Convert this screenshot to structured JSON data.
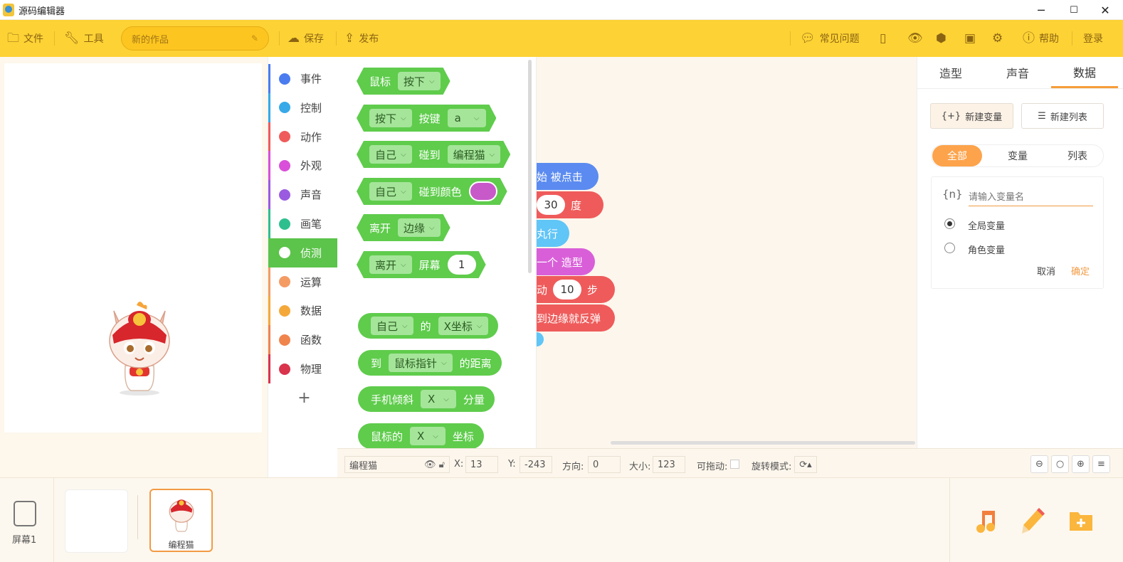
{
  "window": {
    "title": "源码编辑器",
    "min": "─",
    "max": "☐",
    "close": "✕"
  },
  "toolbar": {
    "file_label": "文件",
    "tools_label": "工具",
    "project_name": "新的作品",
    "save_label": "保存",
    "publish_label": "发布",
    "faq_label": "常见问题",
    "help_label": "帮助",
    "login_label": "登录"
  },
  "categories": [
    {
      "label": "事件",
      "color": "#4a7cf0"
    },
    {
      "label": "控制",
      "color": "#37a9e8"
    },
    {
      "label": "动作",
      "color": "#ef5b5b"
    },
    {
      "label": "外观",
      "color": "#d94fd9"
    },
    {
      "label": "声音",
      "color": "#9a5be0"
    },
    {
      "label": "画笔",
      "color": "#2fbf8f"
    },
    {
      "label": "侦测",
      "color": "#5cc34b"
    },
    {
      "label": "运算",
      "color": "#f49b64"
    },
    {
      "label": "数据",
      "color": "#f4a83a"
    },
    {
      "label": "函数",
      "color": "#f0844d"
    },
    {
      "label": "物理",
      "color": "#d9344c"
    }
  ],
  "add_category": "+",
  "palette": {
    "b1": {
      "t1": "鼠标",
      "d1": "按下"
    },
    "b2": {
      "d1": "按下",
      "t1": "按键",
      "d2": "a"
    },
    "b3": {
      "d1": "自己",
      "t1": "碰到",
      "d2": "编程猫"
    },
    "b4": {
      "d1": "自己",
      "t1": "碰到颜色"
    },
    "b5": {
      "t1": "离开",
      "d1": "边缘"
    },
    "b6": {
      "d1": "离开",
      "t1": "屏幕",
      "v1": "1"
    },
    "b7": {
      "d1": "自己",
      "t1": "的",
      "d2": "X坐标"
    },
    "b8": {
      "t1": "到",
      "d1": "鼠标指针",
      "t2": "的距离"
    },
    "b9": {
      "t1": "手机倾斜",
      "d1": "X",
      "t2": "分量"
    },
    "b10": {
      "t1": "鼠标的",
      "d1": "X",
      "t2": "坐标"
    }
  },
  "script": {
    "s1": "始 被点击",
    "s2_val": "30",
    "s2_unit": "度",
    "s3": "丸行",
    "s4": "一个 造型",
    "s5_pre": "动",
    "s5_val": "10",
    "s5_unit": "步",
    "s6": "到边缘就反弹"
  },
  "right_tabs": [
    "造型",
    "声音",
    "数据"
  ],
  "right": {
    "new_var": "新建变量",
    "new_var_icon": "{+}",
    "new_list": "新建列表",
    "filters": [
      "全部",
      "变量",
      "列表"
    ],
    "var_icon": "{n}",
    "var_placeholder": "请输入变量名",
    "global_var": "全局变量",
    "role_var": "角色变量",
    "cancel": "取消",
    "confirm": "确定"
  },
  "status": {
    "sprite_name": "编程猫",
    "x_label": "X:",
    "x_value": "13",
    "y_label": "Y:",
    "y_value": "-243",
    "dir_label": "方向:",
    "dir_value": "0",
    "size_label": "大小:",
    "size_value": "123",
    "drag_label": "可拖动:",
    "rot_label": "旋转模式:"
  },
  "bottom": {
    "screen_label": "屏幕1",
    "sprite_label": "编程猫"
  },
  "colors": {
    "toolbar": "#fdd235",
    "accent": "#f69d3a",
    "sense_green": "#5fcc4c"
  }
}
